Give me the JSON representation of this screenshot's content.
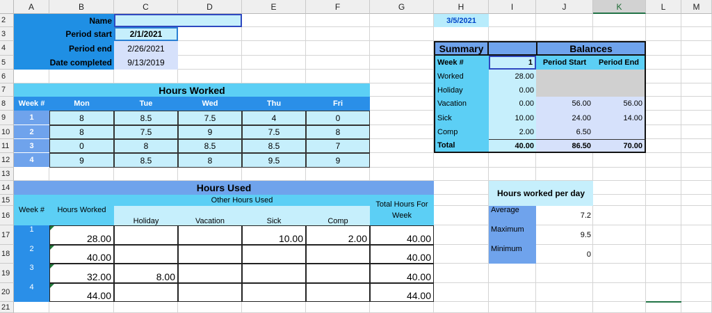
{
  "columns": [
    "A",
    "B",
    "C",
    "D",
    "E",
    "F",
    "G",
    "H",
    "I",
    "J",
    "K",
    "L",
    "M"
  ],
  "rows": [
    "2",
    "3",
    "4",
    "5",
    "6",
    "7",
    "8",
    "9",
    "10",
    "11",
    "12",
    "13",
    "14",
    "15",
    "16",
    "17",
    "18",
    "19",
    "20",
    "21"
  ],
  "info": {
    "name_label": "Name",
    "name_value": "",
    "period_start_label": "Period start",
    "period_start_value": "2/1/2021",
    "period_end_label": "Period end",
    "period_end_value": "2/26/2021",
    "date_completed_label": "Date completed",
    "date_completed_value": "9/13/2019",
    "h2_date": "3/5/2021"
  },
  "hours_worked": {
    "title": "Hours Worked",
    "headers": [
      "Week #",
      "Mon",
      "Tue",
      "Wed",
      "Thu",
      "Fri"
    ],
    "rows": [
      [
        "1",
        "8",
        "8.5",
        "7.5",
        "4",
        "0"
      ],
      [
        "2",
        "8",
        "7.5",
        "9",
        "7.5",
        "8"
      ],
      [
        "3",
        "0",
        "8",
        "8.5",
        "8.5",
        "7"
      ],
      [
        "4",
        "9",
        "8.5",
        "8",
        "9.5",
        "9"
      ]
    ]
  },
  "summary": {
    "title": "Summary",
    "week_label": "Week #",
    "week_value": "1",
    "rows": [
      {
        "label": "Worked",
        "value": "28.00"
      },
      {
        "label": "Holiday",
        "value": "0.00"
      },
      {
        "label": "Vacation",
        "value": "0.00"
      },
      {
        "label": "Sick",
        "value": "10.00"
      },
      {
        "label": "Comp",
        "value": "2.00"
      },
      {
        "label": "Total",
        "value": "40.00"
      }
    ]
  },
  "balances": {
    "title": "Balances",
    "headers": [
      "Period Start",
      "Period End"
    ],
    "rows": [
      {
        "start": "56.00",
        "end": "56.00"
      },
      {
        "start": "24.00",
        "end": "14.00"
      },
      {
        "start": "6.50",
        "end": ""
      },
      {
        "start": "86.50",
        "end": "70.00"
      }
    ]
  },
  "hours_used": {
    "title": "Hours Used",
    "other_header": "Other Hours Used",
    "week_header": "Week #",
    "worked_header": "Hours Worked",
    "sub_headers": [
      "Holiday",
      "Vacation",
      "Sick",
      "Comp"
    ],
    "total_header": "Total Hours For Week",
    "rows": [
      {
        "week": "1",
        "worked": "28.00",
        "holiday": "",
        "vacation": "",
        "sick": "10.00",
        "comp": "2.00",
        "total": "40.00"
      },
      {
        "week": "2",
        "worked": "40.00",
        "holiday": "",
        "vacation": "",
        "sick": "",
        "comp": "",
        "total": "40.00"
      },
      {
        "week": "3",
        "worked": "32.00",
        "holiday": "8.00",
        "vacation": "",
        "sick": "",
        "comp": "",
        "total": "40.00"
      },
      {
        "week": "4",
        "worked": "44.00",
        "holiday": "",
        "vacation": "",
        "sick": "",
        "comp": "",
        "total": "44.00"
      }
    ]
  },
  "per_day": {
    "title": "Hours worked per day",
    "rows": [
      {
        "label": "Average",
        "value": "7.2"
      },
      {
        "label": "Maximum",
        "value": "9.5"
      },
      {
        "label": "Minimum",
        "value": "0"
      }
    ]
  },
  "colors": {
    "dark_blue": "#1f8fe4",
    "header_blue": "#2a8fe8",
    "light_blue": "#c6effc",
    "cyan": "#5ccff5",
    "periwinkle": "#6fa3ec",
    "lavender": "#d6e1fb",
    "gray_cell": "#d0d0d0",
    "date_bg": "#b8ecfc",
    "date_fg": "#0046c8",
    "selected_col": "#217346"
  }
}
